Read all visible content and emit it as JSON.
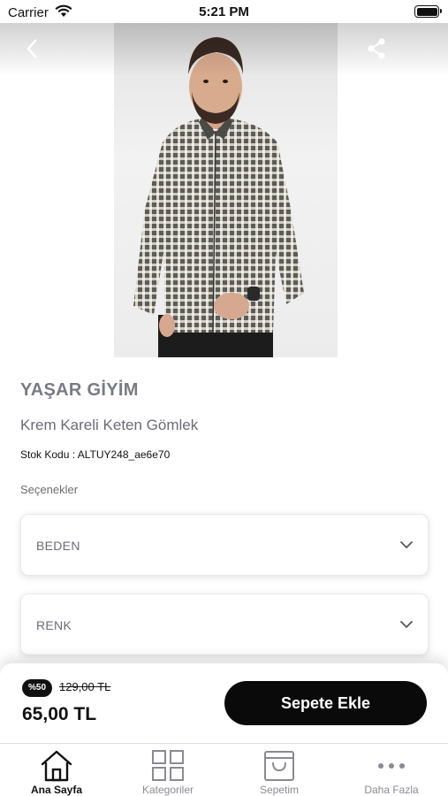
{
  "status_bar": {
    "carrier": "Carrier",
    "time": "5:21 PM"
  },
  "header": {
    "back_icon": "chevron-left-icon",
    "share_icon": "share-icon"
  },
  "product": {
    "brand": "YAŞAR GİYİM",
    "name": "Krem Kareli Keten Gömlek",
    "sku": "Stok Kodu : ALTUY248_ae6e70"
  },
  "options": {
    "label": "Seçenekler",
    "selects": [
      {
        "label": "BEDEN"
      },
      {
        "label": "RENK"
      }
    ]
  },
  "price": {
    "discount": "%50",
    "old_price": "129,00 TL",
    "new_price": "65,00 TL",
    "add_to_cart": "Sepete Ekle"
  },
  "tabs": [
    {
      "label": "Ana Sayfa",
      "icon": "home-icon",
      "active": true
    },
    {
      "label": "Kategoriler",
      "icon": "grid-icon",
      "active": false
    },
    {
      "label": "Sepetim",
      "icon": "shopping-bag-icon",
      "active": false
    },
    {
      "label": "Daha Fazla",
      "icon": "more-icon",
      "active": false
    }
  ],
  "colors": {
    "accent": "#0a0a0a",
    "muted_text": "#7a7a85"
  }
}
